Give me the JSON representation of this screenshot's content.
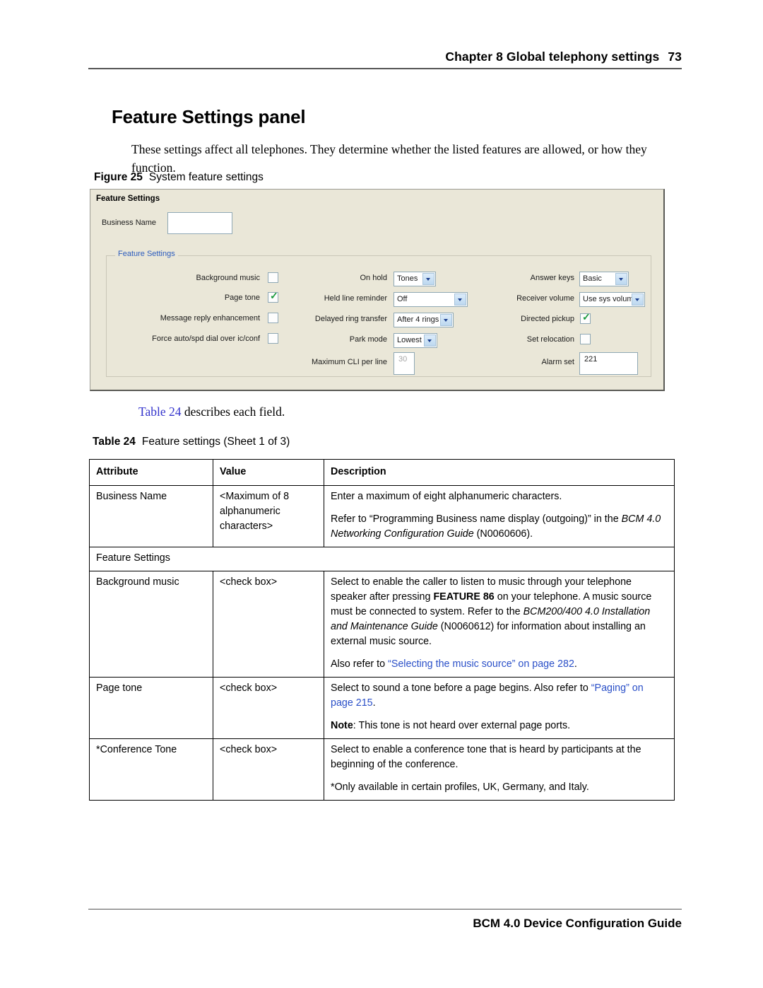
{
  "header": {
    "chapter": "Chapter 8  Global telephony settings",
    "page_number": "73"
  },
  "section": {
    "title": "Feature Settings panel",
    "intro": "These settings affect all telephones. They determine whether the listed features are allowed, or how they function."
  },
  "figure": {
    "label": "Figure 25",
    "caption": "System feature settings"
  },
  "screenshot": {
    "panel_title": "Feature Settings",
    "business_name_label": "Business Name",
    "business_name_value": "",
    "group_legend": "Feature Settings",
    "colors": {
      "panel_background": "#EAE7D8",
      "legend_blue": "#2B5BBD",
      "check_green": "#1A9A3C",
      "field_border": "#8FA8B5"
    },
    "column_left": [
      {
        "label": "Background music",
        "type": "checkbox",
        "checked": false
      },
      {
        "label": "Page tone",
        "type": "checkbox",
        "checked": true
      },
      {
        "label": "Message reply enhancement",
        "type": "checkbox",
        "checked": false
      },
      {
        "label": "Force auto/spd dial over ic/conf",
        "type": "checkbox",
        "checked": false
      }
    ],
    "column_middle": [
      {
        "label": "On hold",
        "type": "dropdown",
        "value": "Tones"
      },
      {
        "label": "Held line reminder",
        "type": "dropdown",
        "value": "Off"
      },
      {
        "label": "Delayed ring transfer",
        "type": "dropdown",
        "value": "After 4 rings"
      },
      {
        "label": "Park mode",
        "type": "dropdown",
        "value": "Lowest"
      },
      {
        "label": "Maximum CLI per line",
        "type": "textbox",
        "value": "30",
        "disabled": true
      }
    ],
    "column_right": [
      {
        "label": "Answer keys",
        "type": "dropdown",
        "value": "Basic"
      },
      {
        "label": "Receiver volume",
        "type": "dropdown",
        "value": "Use sys volume"
      },
      {
        "label": "Directed pickup",
        "type": "checkbox",
        "checked": true
      },
      {
        "label": "Set relocation",
        "type": "checkbox",
        "checked": false
      },
      {
        "label": "Alarm set",
        "type": "textbox",
        "value": "221",
        "disabled": false
      }
    ]
  },
  "table_ref": {
    "link": "Table 24",
    "rest": " describes each field."
  },
  "table": {
    "caption_label": "Table 24",
    "caption_text": "Feature settings (Sheet 1 of 3)",
    "headers": [
      "Attribute",
      "Value",
      "Description"
    ],
    "rows": [
      {
        "kind": "data",
        "attribute": "Business Name",
        "value": "<Maximum of 8 alphanumeric characters>",
        "description_paragraphs": [
          {
            "parts": [
              {
                "t": "Enter a maximum of eight alphanumeric characters."
              }
            ]
          },
          {
            "parts": [
              {
                "t": "Refer to  “Programming Business name display (outgoing)” in the "
              },
              {
                "t": "BCM 4.0 Networking Configuration Guide",
                "style": "italic"
              },
              {
                "t": " (N0060606)."
              }
            ]
          }
        ]
      },
      {
        "kind": "section",
        "attribute": "Feature Settings"
      },
      {
        "kind": "data",
        "attribute": "Background music",
        "value": "<check box>",
        "description_paragraphs": [
          {
            "parts": [
              {
                "t": "Select to enable the caller to listen to music through your telephone speaker after pressing "
              },
              {
                "t": "FEATURE  86",
                "style": "bold"
              },
              {
                "t": " on your telephone. A music source must be connected to system. Refer to the "
              },
              {
                "t": "BCM200/400 4.0 Installation and Maintenance Guide",
                "style": "italic"
              },
              {
                "t": " (N0060612) for information about installing an external music source."
              }
            ]
          },
          {
            "parts": [
              {
                "t": "Also refer to "
              },
              {
                "t": "“Selecting the music source” on page 282",
                "style": "link"
              },
              {
                "t": "."
              }
            ]
          }
        ]
      },
      {
        "kind": "data",
        "attribute": "Page tone",
        "value": "<check box>",
        "description_paragraphs": [
          {
            "parts": [
              {
                "t": "Select to sound a tone before a page begins. Also refer to "
              },
              {
                "t": "“Paging” on page 215",
                "style": "link"
              },
              {
                "t": "."
              }
            ]
          },
          {
            "parts": [
              {
                "t": "Note",
                "style": "bold"
              },
              {
                "t": ": This tone is not heard over external page ports."
              }
            ]
          }
        ]
      },
      {
        "kind": "data",
        "attribute": "*Conference Tone",
        "value": "<check box>",
        "description_paragraphs": [
          {
            "parts": [
              {
                "t": "Select to enable a conference tone that is heard by participants at the beginning of the conference."
              }
            ]
          },
          {
            "parts": [
              {
                "t": "*Only available in certain profiles, UK, Germany, and Italy."
              }
            ]
          }
        ]
      }
    ]
  },
  "footer": {
    "text": "BCM 4.0 Device Configuration Guide"
  }
}
